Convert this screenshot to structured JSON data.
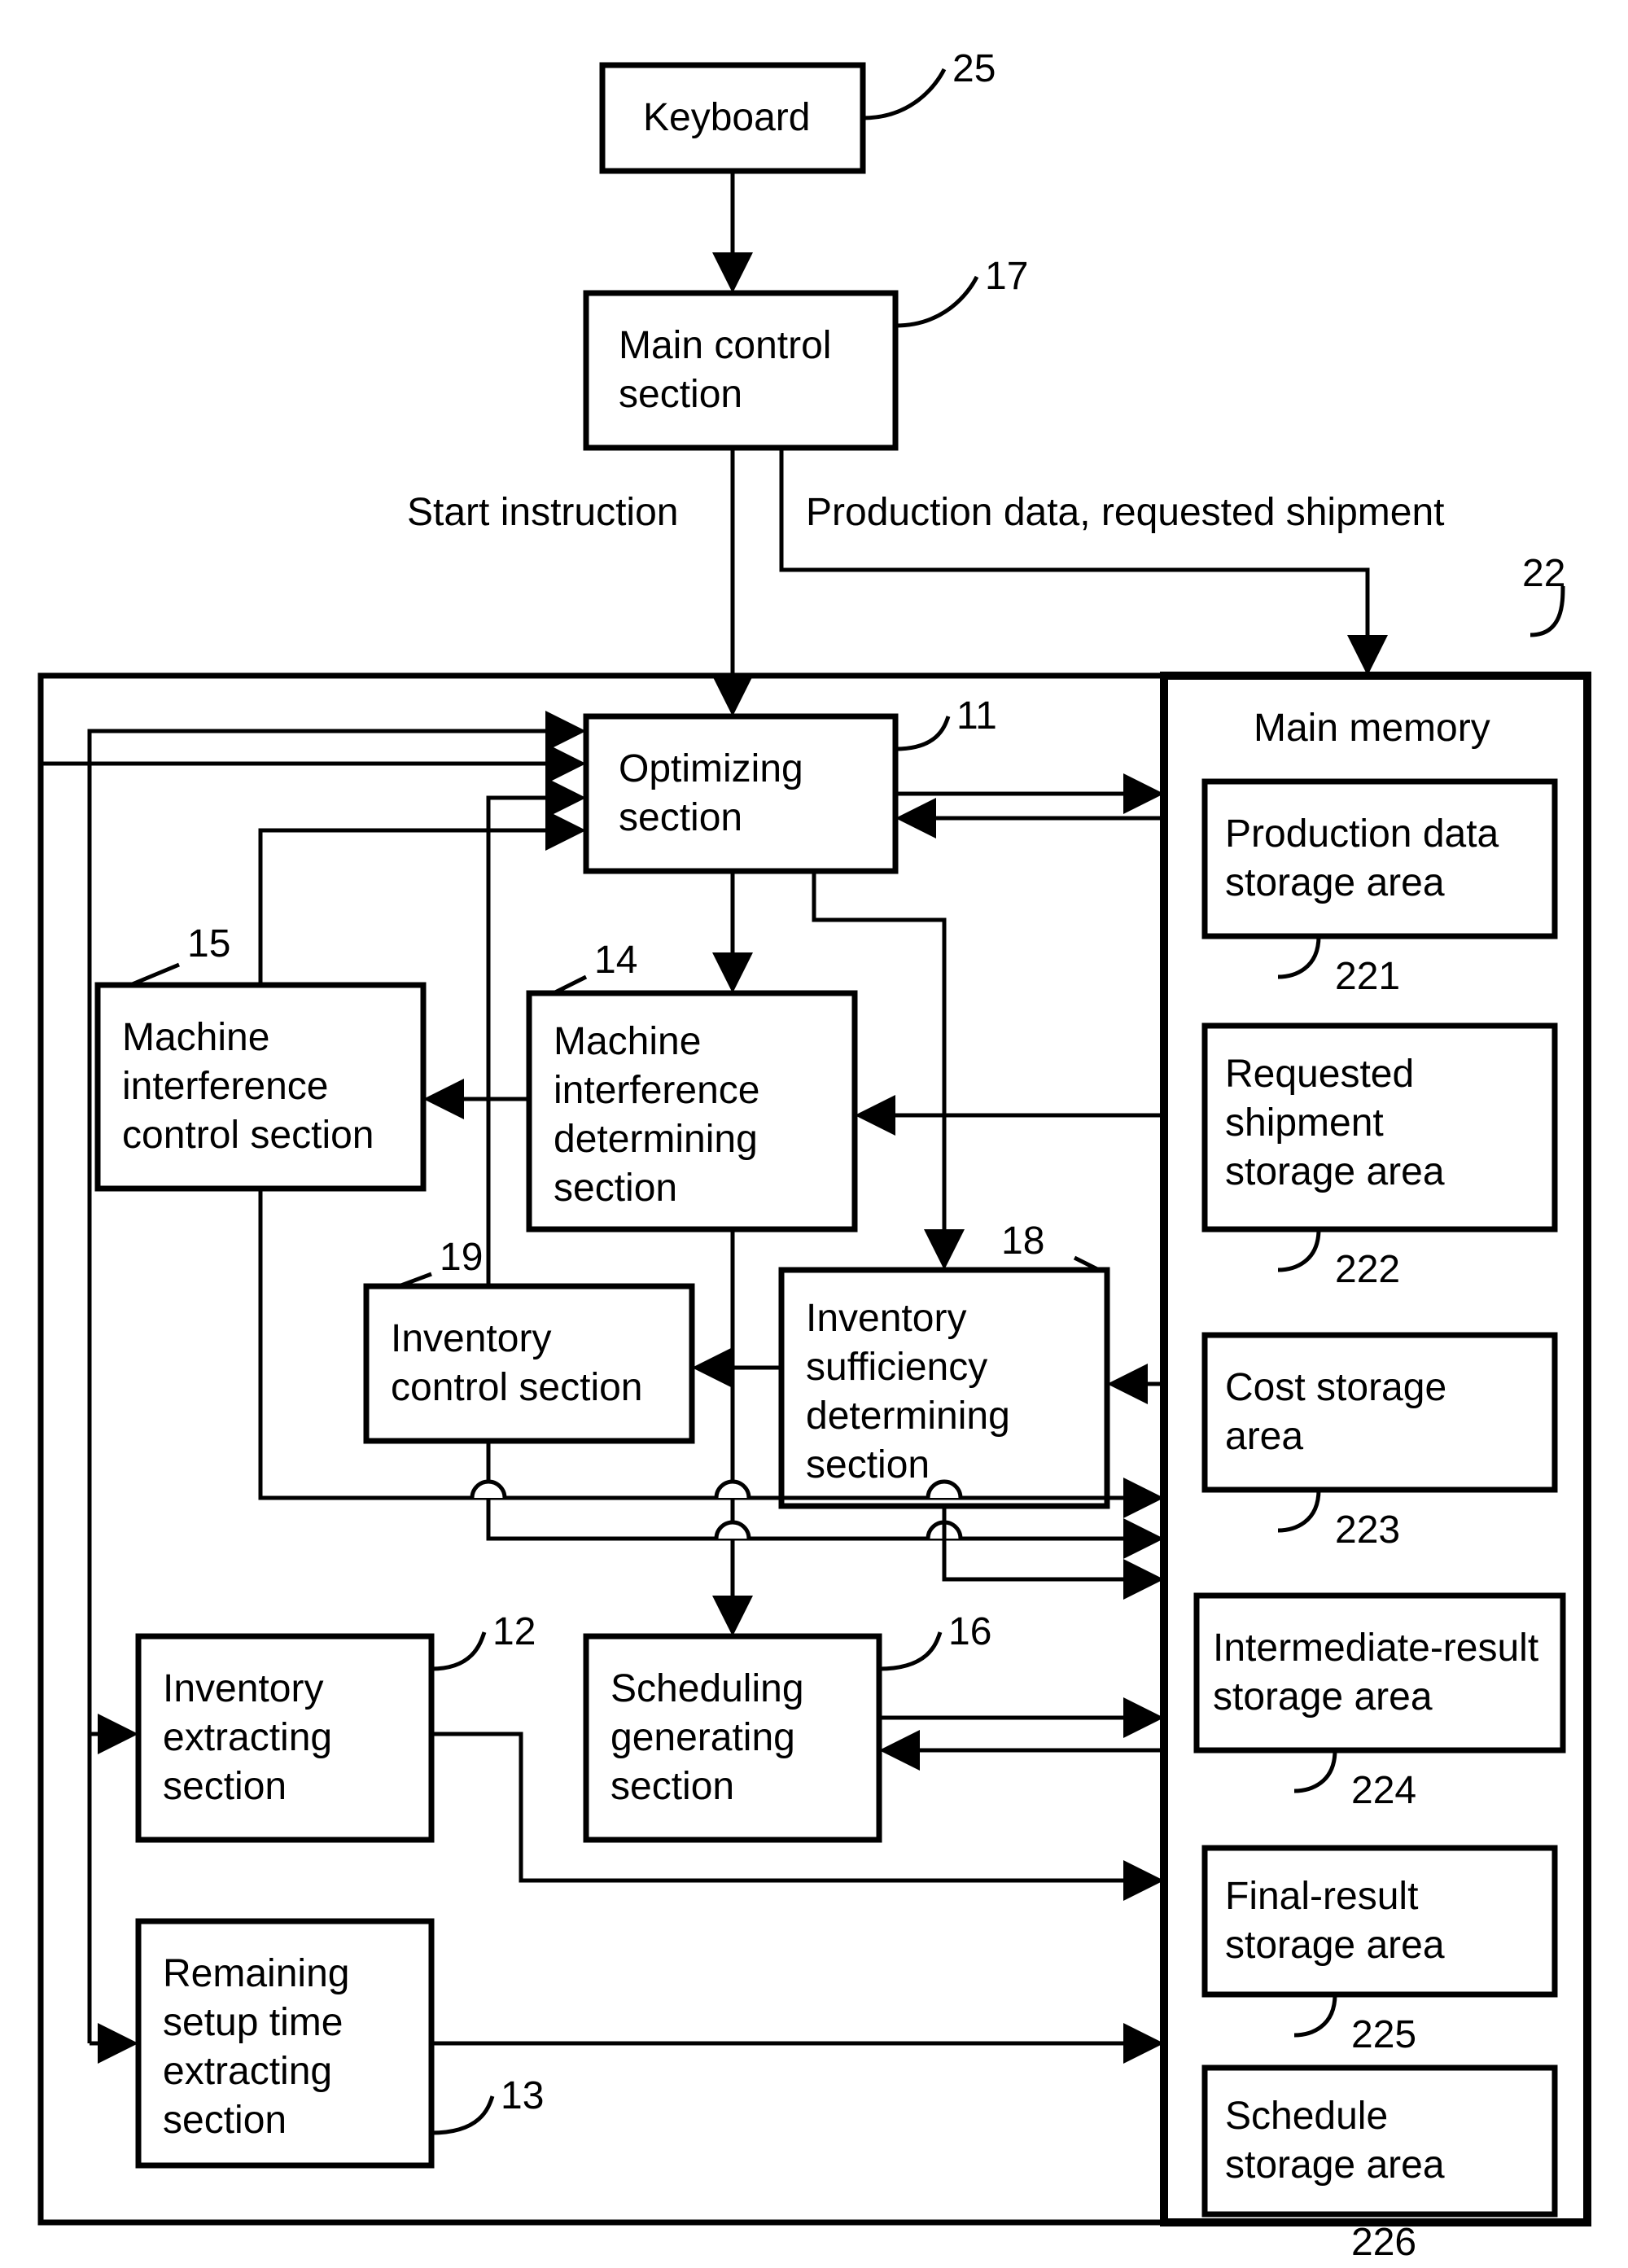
{
  "nodes": {
    "keyboard": {
      "label": "Keyboard",
      "ref": "25"
    },
    "main_control": {
      "label1": "Main control",
      "label2": "section",
      "ref": "17"
    },
    "start_instruction": {
      "label": "Start instruction"
    },
    "production_data_label": {
      "label": "Production data, requested shipment"
    },
    "optimizing": {
      "label1": "Optimizing",
      "label2": "section",
      "ref": "11"
    },
    "machine_interf_control": {
      "label1": "Machine",
      "label2": "interference",
      "label3": "control section",
      "ref": "15"
    },
    "machine_interf_det": {
      "label1": "Machine",
      "label2": "interference",
      "label3": "determining",
      "label4": "section",
      "ref": "14"
    },
    "inventory_control": {
      "label1": "Inventory",
      "label2": "control section",
      "ref": "19"
    },
    "inventory_suff": {
      "label1": "Inventory",
      "label2": "sufficiency",
      "label3": "determining",
      "label4": "section",
      "ref": "18"
    },
    "inventory_extracting": {
      "label1": "Inventory",
      "label2": "extracting",
      "label3": "section",
      "ref": "12"
    },
    "scheduling": {
      "label1": "Scheduling",
      "label2": "generating",
      "label3": "section",
      "ref": "16"
    },
    "remaining_setup": {
      "label1": "Remaining",
      "label2": "setup time",
      "label3": "extracting",
      "label4": "section",
      "ref": "13"
    },
    "main_memory": {
      "label": "Main memory",
      "ref": "22"
    },
    "mem_production": {
      "label1": "Production data",
      "label2": "storage area",
      "ref": "221"
    },
    "mem_requested": {
      "label1": "Requested",
      "label2": "shipment",
      "label3": "storage area",
      "ref": "222"
    },
    "mem_cost": {
      "label1": "Cost storage",
      "label2": "area",
      "ref": "223"
    },
    "mem_intermediate": {
      "label1": "Intermediate-result",
      "label2": "storage area",
      "ref": "224"
    },
    "mem_final": {
      "label1": "Final-result",
      "label2": "storage area",
      "ref": "225"
    },
    "mem_schedule": {
      "label1": "Schedule",
      "label2": "storage area",
      "ref": "226"
    }
  }
}
